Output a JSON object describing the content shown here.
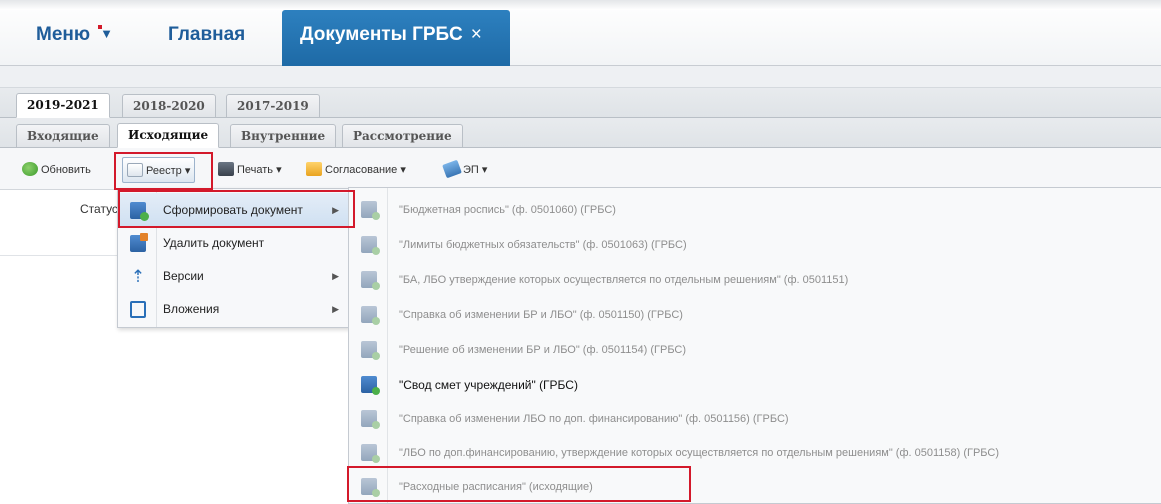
{
  "nav": {
    "menu_label": "Меню",
    "home_label": "Главная",
    "active_tab_label": "Документы ГРБС",
    "close_glyph": "×"
  },
  "year_tabs": [
    {
      "label": "2019-2021",
      "active": true
    },
    {
      "label": "2018-2020",
      "active": false
    },
    {
      "label": "2017-2019",
      "active": false
    }
  ],
  "doc_tabs": [
    {
      "label": "Входящие",
      "active": false
    },
    {
      "label": "Исходящие",
      "active": true
    },
    {
      "label": "Внутренние",
      "active": false
    },
    {
      "label": "Рассмотрение",
      "active": false
    }
  ],
  "toolbar": {
    "refresh_label": "Обновить",
    "registry_label": "Реестр",
    "print_label": "Печать",
    "approval_label": "Согласование",
    "sign_label": "ЭП",
    "dropdown_glyph": "▾"
  },
  "grid": {
    "status_column": "Статус"
  },
  "context_menu": {
    "items": [
      {
        "label": "Сформировать документ",
        "icon": "create-document-icon",
        "has_submenu": true
      },
      {
        "label": "Удалить документ",
        "icon": "delete-document-icon",
        "has_submenu": false
      },
      {
        "label": "Версии",
        "icon": "versions-icon",
        "has_submenu": true
      },
      {
        "label": "Вложения",
        "icon": "attachments-icon",
        "has_submenu": true
      }
    ],
    "arrow_glyph": "▶"
  },
  "submenu": {
    "items": [
      {
        "label": "\"Бюджетная роспись\" (ф. 0501060) (ГРБС)",
        "enabled": false
      },
      {
        "label": "\"Лимиты бюджетных обязательств\" (ф. 0501063) (ГРБС)",
        "enabled": false
      },
      {
        "label": "\"БА, ЛБО утверждение которых осуществляется по отдельным решениям\" (ф. 0501151)",
        "enabled": false
      },
      {
        "label": "\"Справка об изменении БР и ЛБО\" (ф. 0501150) (ГРБС)",
        "enabled": false
      },
      {
        "label": "\"Решение об изменении БР и ЛБО\" (ф. 0501154) (ГРБС)",
        "enabled": false
      },
      {
        "label": "\"Свод смет учреждений\" (ГРБС)",
        "enabled": true
      },
      {
        "label": "\"Справка об изменении ЛБО по доп. финансированию\" (ф. 0501156) (ГРБС)",
        "enabled": false
      },
      {
        "label": "\"ЛБО по доп.финансированию, утверждение которых осуществляется по отдельным решениям\" (ф. 0501158) (ГРБС)",
        "enabled": false
      },
      {
        "label": "\"Расходные расписания\" (исходящие)",
        "enabled": false
      }
    ]
  },
  "colors": {
    "accent": "#1e6aa6",
    "highlight_box": "#d3192b"
  }
}
